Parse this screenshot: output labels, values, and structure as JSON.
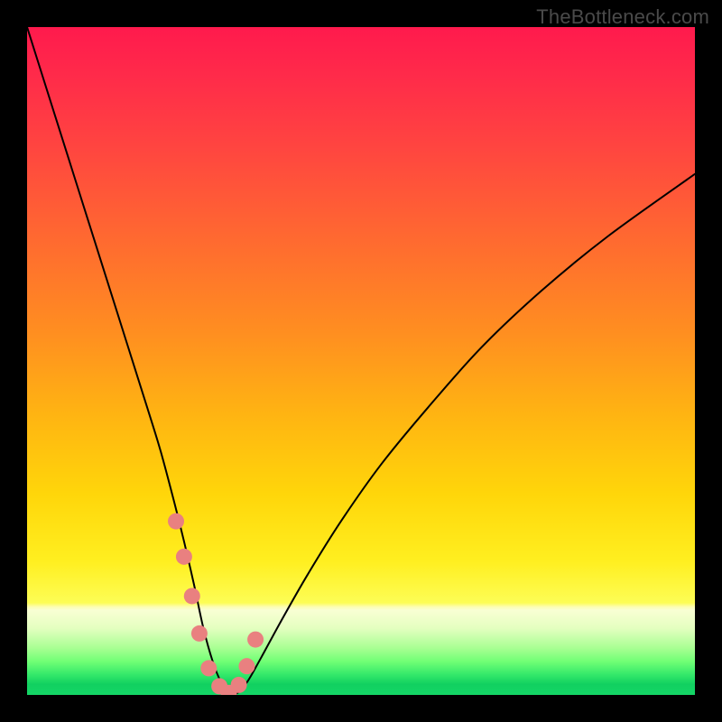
{
  "watermark": "TheBottleneck.com",
  "colors": {
    "background": "#000000",
    "curve": "#000000",
    "marker": "#e98080",
    "gradient_top": "#ff1a4d",
    "gradient_bottom": "#14d666"
  },
  "chart_data": {
    "type": "line",
    "title": "",
    "xlabel": "",
    "ylabel": "",
    "xlim": [
      0,
      100
    ],
    "ylim": [
      0,
      100
    ],
    "grid": false,
    "series": [
      {
        "name": "bottleneck-curve",
        "x": [
          0,
          3,
          6,
          9,
          12,
          15,
          18,
          20,
          22,
          23.5,
          25,
          26.4,
          27.8,
          29,
          30.2,
          31.5,
          33,
          35,
          38,
          42,
          47,
          53,
          60,
          68,
          77,
          87,
          100
        ],
        "y": [
          100,
          90.5,
          81,
          71.5,
          62,
          52.5,
          43,
          36.5,
          29,
          23,
          16.5,
          10,
          5,
          2,
          0.3,
          0.3,
          2,
          5.5,
          11,
          18,
          26,
          34.5,
          43,
          52,
          60.5,
          68.7,
          78
        ]
      }
    ],
    "markers": {
      "name": "bottleneck-markers",
      "x": [
        22.3,
        23.5,
        24.7,
        25.8,
        27.2,
        28.8,
        30.2,
        31.7,
        32.9,
        34.2
      ],
      "y": [
        26.0,
        20.7,
        14.8,
        9.2,
        4.0,
        1.3,
        0.3,
        1.5,
        4.3,
        8.3
      ],
      "radius_px": 9
    }
  }
}
